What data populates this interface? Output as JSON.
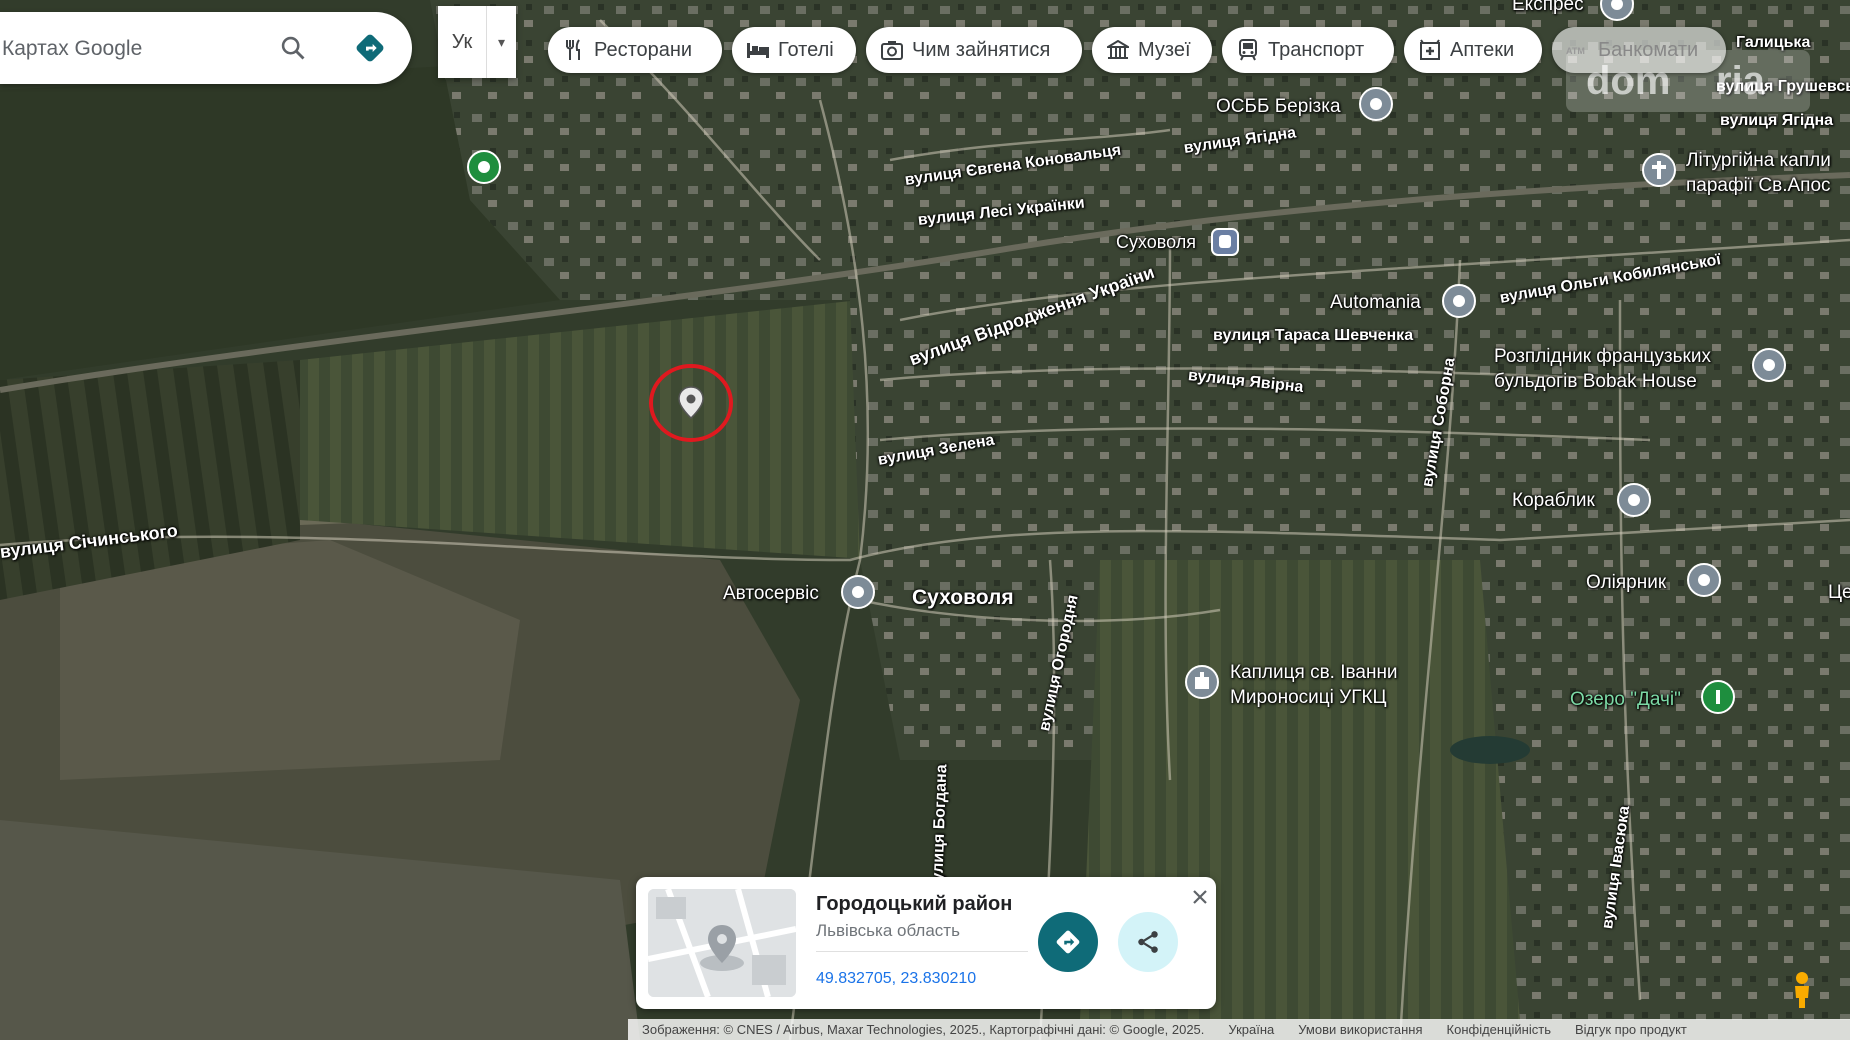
{
  "search": {
    "placeholder": "Шукайте на Картах Google",
    "visible_text": "Картах Google"
  },
  "language": {
    "code": "Ук"
  },
  "chips": [
    {
      "label": "Ресторани",
      "icon": "restaurant-icon"
    },
    {
      "label": "Готелі",
      "icon": "hotel-icon"
    },
    {
      "label": "Чим зайнятися",
      "icon": "camera-icon"
    },
    {
      "label": "Музеї",
      "icon": "museum-icon"
    },
    {
      "label": "Транспорт",
      "icon": "transit-icon"
    },
    {
      "label": "Аптеки",
      "icon": "pharmacy-icon"
    },
    {
      "label": "Банкомати",
      "icon": "atm-icon"
    }
  ],
  "map": {
    "streets": [
      "вулиця Євгена Коновальця",
      "вулиця Лесі Українки",
      "вулиця Відродження України",
      "вулиця Тараса Шевченка",
      "вулиця Явірна",
      "вулиця Зелена",
      "вулиця Січинського",
      "вулиця Ольги Кобилянської",
      "вулиця Ягідна",
      "вулиця Соборна",
      "вулиця Огородня",
      "вулиця Богдана",
      "вулиця Івасюка",
      "вулиця Ягідна",
      "Галицька",
      "вулиця Грушевського"
    ],
    "pois": [
      {
        "name": "ОСББ Берізка"
      },
      {
        "name": "Суховоля"
      },
      {
        "name": "Automania"
      },
      {
        "name": "Розплідник французьких",
        "name2": "бульдогів Bobak House"
      },
      {
        "name": "Кораблик"
      },
      {
        "name": "Оліярник"
      },
      {
        "name": "Автосервіс"
      },
      {
        "name": "Каплиця св. Іванни",
        "name2": "Мироносиці УГКЦ"
      },
      {
        "name": "Озеро \"Дачі\""
      },
      {
        "name": "Літургійна капли",
        "name2": "парафії Св.Апос"
      },
      {
        "name": "Експрес"
      },
      {
        "name": "Це"
      }
    ],
    "town": "Суховоля"
  },
  "card": {
    "title": "Городоцький район",
    "subtitle": "Львівська область",
    "coords": "49.832705, 23.830210"
  },
  "footer": {
    "imagery": "Зображення: © CNES / Airbus, Maxar Technologies, 2025., Картографічні дані: © Google, 2025.",
    "country": "Україна",
    "terms": "Умови використання",
    "privacy": "Конфіденційність",
    "feedback": "Відгук про продукт"
  },
  "watermark": "dom ria",
  "colors": {
    "accent": "#0f6b78",
    "marker_ring": "#e0191f",
    "map_base": "#2f3a2a"
  }
}
